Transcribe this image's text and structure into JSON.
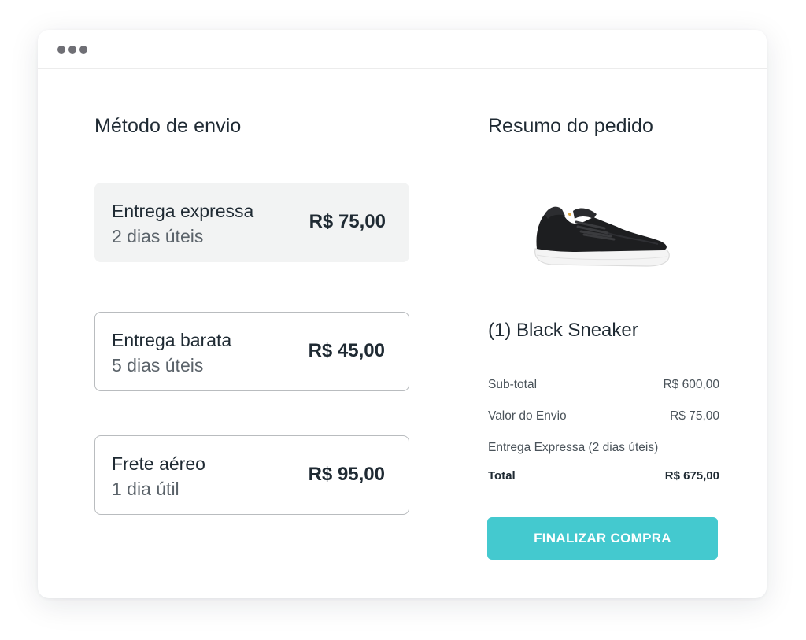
{
  "shipping": {
    "heading": "Método de envio",
    "options": [
      {
        "name": "Entrega expressa",
        "days": "2 dias úteis",
        "price": "R$ 75,00",
        "selected": true
      },
      {
        "name": "Entrega barata",
        "days": "5 dias úteis",
        "price": "R$ 45,00",
        "selected": false
      },
      {
        "name": "Frete aéreo",
        "days": "1 dia útil",
        "price": "R$ 95,00",
        "selected": false
      }
    ]
  },
  "summary": {
    "heading": "Resumo do pedido",
    "product": {
      "title": "(1) Black Sneaker",
      "image_icon": "sneaker-image"
    },
    "rows": {
      "subtotal": {
        "label": "Sub-total",
        "value": "R$ 600,00"
      },
      "shipping": {
        "label": "Valor do Envio",
        "value": "R$ 75,00"
      },
      "shipping_note": "Entrega Expressa (2 dias úteis)",
      "total": {
        "label": "Total",
        "value": "R$ 675,00"
      }
    },
    "checkout_label": "FINALIZAR COMPRA"
  },
  "colors": {
    "accent": "#44c9cf",
    "selected_bg": "#f2f3f3",
    "text": "#1f2a33",
    "muted": "#5b636a"
  }
}
